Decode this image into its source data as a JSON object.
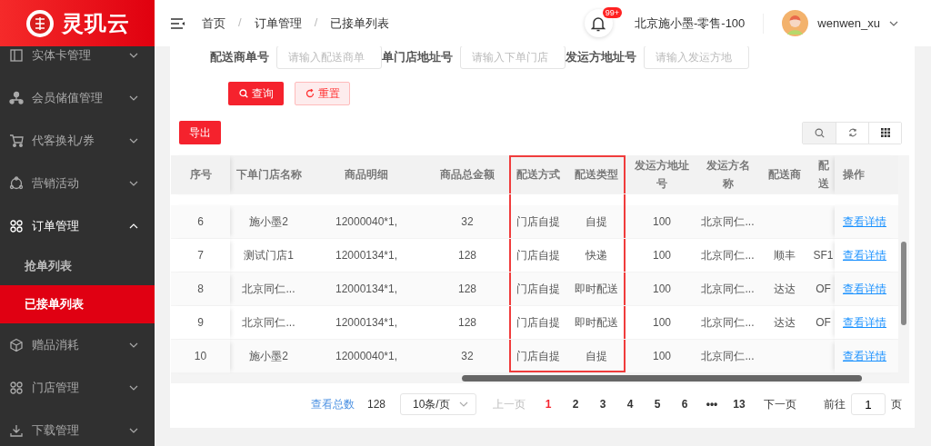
{
  "logo": {
    "text": "灵玑云"
  },
  "sidebar": {
    "items": [
      {
        "label": "实体卡管理",
        "expanded": false
      },
      {
        "label": "会员储值管理",
        "expanded": false
      },
      {
        "label": "代客换礼/券",
        "expanded": false
      },
      {
        "label": "营销活动",
        "expanded": false
      },
      {
        "label": "订单管理",
        "expanded": true,
        "children": [
          {
            "label": "抢单列表",
            "selected": false
          },
          {
            "label": "已接单列表",
            "selected": true
          }
        ]
      },
      {
        "label": "赠品消耗",
        "expanded": false
      },
      {
        "label": "门店管理",
        "expanded": false
      },
      {
        "label": "下载管理",
        "expanded": false
      }
    ]
  },
  "breadcrumb": [
    "首页",
    "订单管理",
    "已接单列表"
  ],
  "breadcrumb_separator": "/",
  "header": {
    "notification_badge": "99+",
    "store": "北京施小墨-零售-100",
    "user": "wenwen_xu"
  },
  "filters": [
    {
      "label": "配送商单号",
      "placeholder": "请输入配送商单"
    },
    {
      "label": "单门店地址号",
      "placeholder": "请输入下单门店"
    },
    {
      "label": "发运方地址号",
      "placeholder": "请输入发运方地"
    }
  ],
  "buttons": {
    "query": "查询",
    "reset": "重置",
    "export": "导出"
  },
  "table": {
    "columns": [
      {
        "label": "序号",
        "highlighted": false
      },
      {
        "label": "下单门店名称",
        "highlighted": false
      },
      {
        "label": "商品明细",
        "highlighted": false
      },
      {
        "label": "商品总金额",
        "highlighted": false
      },
      {
        "label": "配送方式",
        "highlighted": true
      },
      {
        "label": "配送类型",
        "highlighted": true
      },
      {
        "label": "发运方地址号",
        "highlighted": false
      },
      {
        "label": "发运方名称",
        "highlighted": false
      },
      {
        "label": "配送商",
        "highlighted": false
      },
      {
        "label": "配送",
        "highlighted": false
      },
      {
        "label": "操作",
        "highlighted": false
      }
    ],
    "rows": [
      {
        "cells": [
          "6",
          "施小墨2",
          "12000040*1,",
          "32",
          "门店自提",
          "自提",
          "100",
          "北京同仁...",
          "",
          ""
        ],
        "action": "查看详情"
      },
      {
        "cells": [
          "7",
          "测试门店1",
          "12000134*1,",
          "128",
          "门店自提",
          "快递",
          "100",
          "北京同仁...",
          "顺丰",
          "SF1"
        ],
        "action": "查看详情"
      },
      {
        "cells": [
          "8",
          "北京同仁...",
          "12000134*1,",
          "128",
          "门店自提",
          "即时配送",
          "100",
          "北京同仁...",
          "达达",
          "OF"
        ],
        "action": "查看详情"
      },
      {
        "cells": [
          "9",
          "北京同仁...",
          "12000134*1,",
          "128",
          "门店自提",
          "即时配送",
          "100",
          "北京同仁...",
          "达达",
          "OF"
        ],
        "action": "查看详情"
      },
      {
        "cells": [
          "10",
          "施小墨2",
          "12000040*1,",
          "32",
          "门店自提",
          "自提",
          "100",
          "北京同仁...",
          "",
          ""
        ],
        "action": "查看详情"
      }
    ]
  },
  "pagination": {
    "total_label": "查看总数",
    "total": "128",
    "page_size": "10条/页",
    "prev": "上一页",
    "pages": [
      {
        "label": "1",
        "selected": true
      },
      {
        "label": "2",
        "selected": false
      },
      {
        "label": "3",
        "selected": false
      },
      {
        "label": "4",
        "selected": false
      },
      {
        "label": "5",
        "selected": false
      },
      {
        "label": "6",
        "selected": false
      },
      {
        "label": "•••",
        "selected": false
      },
      {
        "label": "13",
        "selected": false
      }
    ],
    "next": "下一页",
    "goto": "前往",
    "goto_value": "1",
    "page_suffix": "页"
  }
}
